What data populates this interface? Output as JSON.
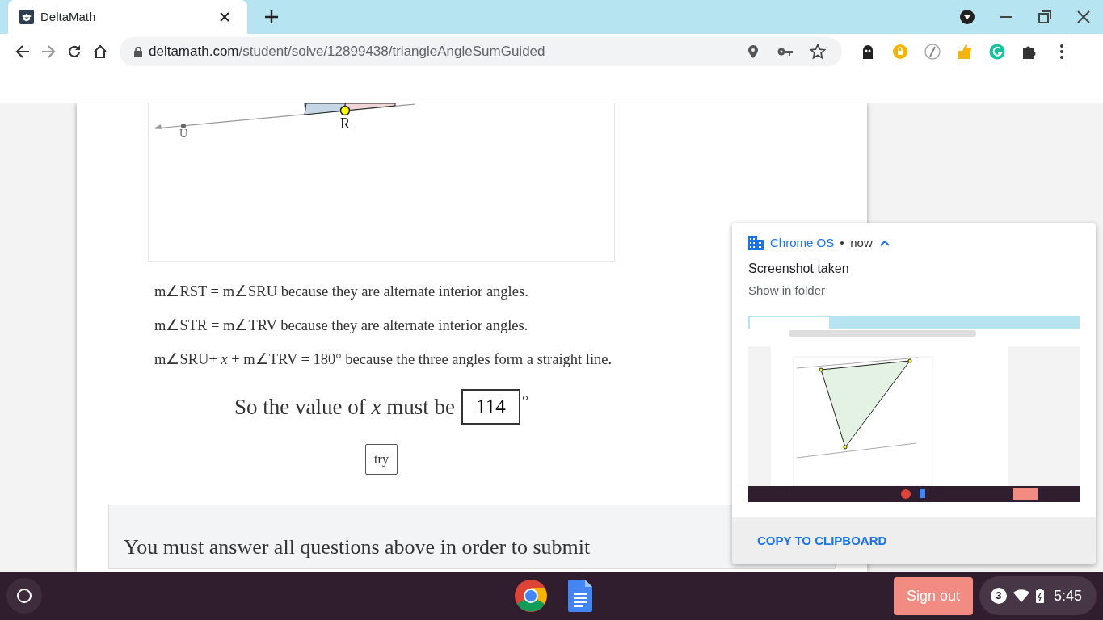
{
  "browser": {
    "tab": {
      "title": "DeltaMath"
    },
    "address": {
      "host": "deltamath.com",
      "path": "/student/solve/12899438/triangleAngleSumGuided"
    }
  },
  "diagram": {
    "points": [
      {
        "label": "U"
      },
      {
        "label": "R"
      }
    ]
  },
  "statements": [
    "m∠RST = m∠SRU because they are alternate interior angles.",
    "m∠STR = m∠TRV because they are alternate interior angles.",
    "m∠SRU+ *x* + m∠TRV = 180° because the three angles form a straight line."
  ],
  "answer": {
    "prompt": "So the value of *x* must be",
    "value": "114",
    "unit": "°"
  },
  "try_button": "try",
  "submit_notice": "You must answer all questions above in order to submit",
  "notification": {
    "source": "Chrome OS",
    "time": "now",
    "expanded": true,
    "title": "Screenshot taken",
    "link": "Show in folder",
    "action": "COPY TO CLIPBOARD"
  },
  "taskbar": {
    "sign_out": "Sign out",
    "notification_count": "3",
    "time": "5:45"
  }
}
